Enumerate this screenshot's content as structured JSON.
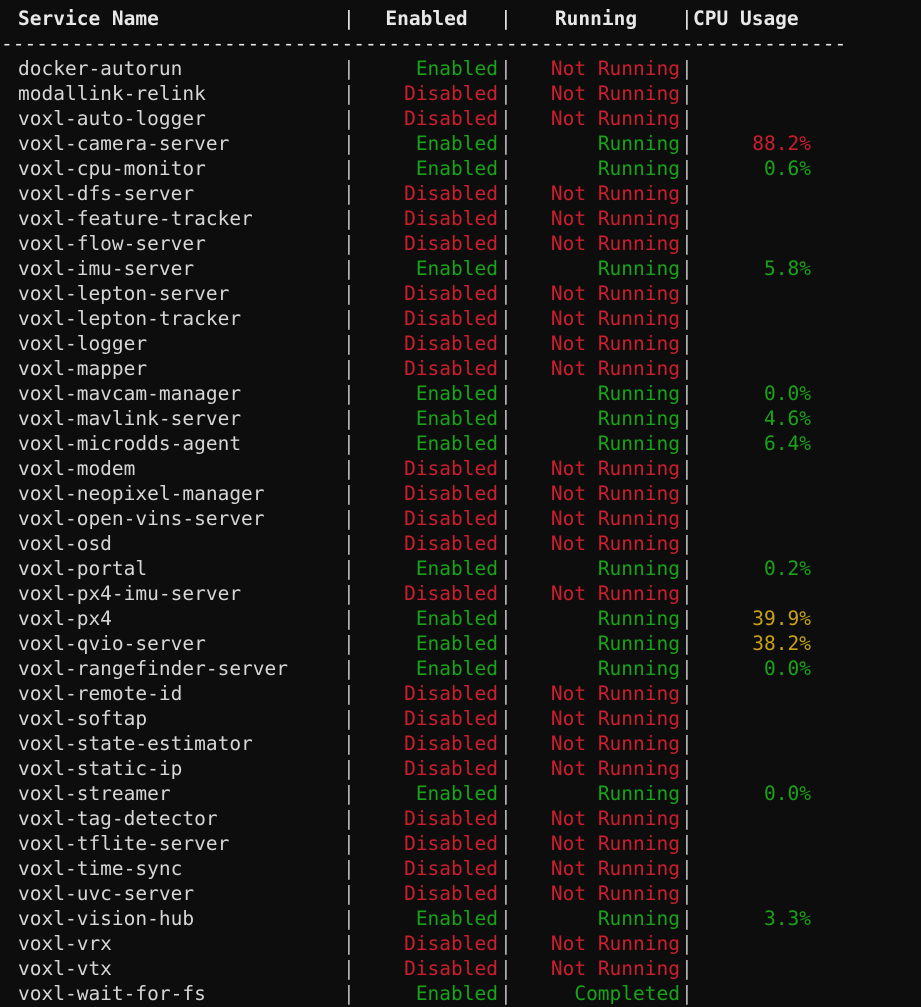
{
  "terminal": {
    "background": "#0d0d0d",
    "foreground": "#d6d6d6",
    "colors": {
      "enabled_green": "#19a319",
      "disabled_red": "#cc1f2e",
      "cpu_warn_yellow": "#c8a217",
      "cpu_crit_red": "#cc1f2e",
      "separator_gray": "#b8b8b8",
      "header_white": "#e8e8e8"
    }
  },
  "header": {
    "service_name": "Service Name",
    "enabled": "Enabled",
    "running": "Running",
    "cpu_usage": "CPU Usage",
    "pipe": "|",
    "divider": "------------------------------------------------------------------------"
  },
  "table": {
    "columns": [
      "Service Name",
      "Enabled",
      "Running",
      "CPU Usage"
    ],
    "rows": [
      {
        "name": "docker-autorun",
        "enabled": "Enabled",
        "running": "Not Running",
        "cpu": "",
        "enabled_state": "on",
        "running_state": "off",
        "cpu_state": "none"
      },
      {
        "name": "modallink-relink",
        "enabled": "Disabled",
        "running": "Not Running",
        "cpu": "",
        "enabled_state": "off",
        "running_state": "off",
        "cpu_state": "none"
      },
      {
        "name": "voxl-auto-logger",
        "enabled": "Disabled",
        "running": "Not Running",
        "cpu": "",
        "enabled_state": "off",
        "running_state": "off",
        "cpu_state": "none"
      },
      {
        "name": "voxl-camera-server",
        "enabled": "Enabled",
        "running": "Running",
        "cpu": "88.2%",
        "enabled_state": "on",
        "running_state": "on",
        "cpu_state": "crit"
      },
      {
        "name": "voxl-cpu-monitor",
        "enabled": "Enabled",
        "running": "Running",
        "cpu": "0.6%",
        "enabled_state": "on",
        "running_state": "on",
        "cpu_state": "ok"
      },
      {
        "name": "voxl-dfs-server",
        "enabled": "Disabled",
        "running": "Not Running",
        "cpu": "",
        "enabled_state": "off",
        "running_state": "off",
        "cpu_state": "none"
      },
      {
        "name": "voxl-feature-tracker",
        "enabled": "Disabled",
        "running": "Not Running",
        "cpu": "",
        "enabled_state": "off",
        "running_state": "off",
        "cpu_state": "none"
      },
      {
        "name": "voxl-flow-server",
        "enabled": "Disabled",
        "running": "Not Running",
        "cpu": "",
        "enabled_state": "off",
        "running_state": "off",
        "cpu_state": "none"
      },
      {
        "name": "voxl-imu-server",
        "enabled": "Enabled",
        "running": "Running",
        "cpu": "5.8%",
        "enabled_state": "on",
        "running_state": "on",
        "cpu_state": "ok"
      },
      {
        "name": "voxl-lepton-server",
        "enabled": "Disabled",
        "running": "Not Running",
        "cpu": "",
        "enabled_state": "off",
        "running_state": "off",
        "cpu_state": "none"
      },
      {
        "name": "voxl-lepton-tracker",
        "enabled": "Disabled",
        "running": "Not Running",
        "cpu": "",
        "enabled_state": "off",
        "running_state": "off",
        "cpu_state": "none"
      },
      {
        "name": "voxl-logger",
        "enabled": "Disabled",
        "running": "Not Running",
        "cpu": "",
        "enabled_state": "off",
        "running_state": "off",
        "cpu_state": "none"
      },
      {
        "name": "voxl-mapper",
        "enabled": "Disabled",
        "running": "Not Running",
        "cpu": "",
        "enabled_state": "off",
        "running_state": "off",
        "cpu_state": "none"
      },
      {
        "name": "voxl-mavcam-manager",
        "enabled": "Enabled",
        "running": "Running",
        "cpu": "0.0%",
        "enabled_state": "on",
        "running_state": "on",
        "cpu_state": "ok"
      },
      {
        "name": "voxl-mavlink-server",
        "enabled": "Enabled",
        "running": "Running",
        "cpu": "4.6%",
        "enabled_state": "on",
        "running_state": "on",
        "cpu_state": "ok"
      },
      {
        "name": "voxl-microdds-agent",
        "enabled": "Enabled",
        "running": "Running",
        "cpu": "6.4%",
        "enabled_state": "on",
        "running_state": "on",
        "cpu_state": "ok"
      },
      {
        "name": "voxl-modem",
        "enabled": "Disabled",
        "running": "Not Running",
        "cpu": "",
        "enabled_state": "off",
        "running_state": "off",
        "cpu_state": "none"
      },
      {
        "name": "voxl-neopixel-manager",
        "enabled": "Disabled",
        "running": "Not Running",
        "cpu": "",
        "enabled_state": "off",
        "running_state": "off",
        "cpu_state": "none"
      },
      {
        "name": "voxl-open-vins-server",
        "enabled": "Disabled",
        "running": "Not Running",
        "cpu": "",
        "enabled_state": "off",
        "running_state": "off",
        "cpu_state": "none"
      },
      {
        "name": "voxl-osd",
        "enabled": "Disabled",
        "running": "Not Running",
        "cpu": "",
        "enabled_state": "off",
        "running_state": "off",
        "cpu_state": "none"
      },
      {
        "name": "voxl-portal",
        "enabled": "Enabled",
        "running": "Running",
        "cpu": "0.2%",
        "enabled_state": "on",
        "running_state": "on",
        "cpu_state": "ok"
      },
      {
        "name": "voxl-px4-imu-server",
        "enabled": "Disabled",
        "running": "Not Running",
        "cpu": "",
        "enabled_state": "off",
        "running_state": "off",
        "cpu_state": "none"
      },
      {
        "name": "voxl-px4",
        "enabled": "Enabled",
        "running": "Running",
        "cpu": "39.9%",
        "enabled_state": "on",
        "running_state": "on",
        "cpu_state": "warn"
      },
      {
        "name": "voxl-qvio-server",
        "enabled": "Enabled",
        "running": "Running",
        "cpu": "38.2%",
        "enabled_state": "on",
        "running_state": "on",
        "cpu_state": "warn"
      },
      {
        "name": "voxl-rangefinder-server",
        "enabled": "Enabled",
        "running": "Running",
        "cpu": "0.0%",
        "enabled_state": "on",
        "running_state": "on",
        "cpu_state": "ok"
      },
      {
        "name": "voxl-remote-id",
        "enabled": "Disabled",
        "running": "Not Running",
        "cpu": "",
        "enabled_state": "off",
        "running_state": "off",
        "cpu_state": "none"
      },
      {
        "name": "voxl-softap",
        "enabled": "Disabled",
        "running": "Not Running",
        "cpu": "",
        "enabled_state": "off",
        "running_state": "off",
        "cpu_state": "none"
      },
      {
        "name": "voxl-state-estimator",
        "enabled": "Disabled",
        "running": "Not Running",
        "cpu": "",
        "enabled_state": "off",
        "running_state": "off",
        "cpu_state": "none"
      },
      {
        "name": "voxl-static-ip",
        "enabled": "Disabled",
        "running": "Not Running",
        "cpu": "",
        "enabled_state": "off",
        "running_state": "off",
        "cpu_state": "none"
      },
      {
        "name": "voxl-streamer",
        "enabled": "Enabled",
        "running": "Running",
        "cpu": "0.0%",
        "enabled_state": "on",
        "running_state": "on",
        "cpu_state": "ok"
      },
      {
        "name": "voxl-tag-detector",
        "enabled": "Disabled",
        "running": "Not Running",
        "cpu": "",
        "enabled_state": "off",
        "running_state": "off",
        "cpu_state": "none"
      },
      {
        "name": "voxl-tflite-server",
        "enabled": "Disabled",
        "running": "Not Running",
        "cpu": "",
        "enabled_state": "off",
        "running_state": "off",
        "cpu_state": "none"
      },
      {
        "name": "voxl-time-sync",
        "enabled": "Disabled",
        "running": "Not Running",
        "cpu": "",
        "enabled_state": "off",
        "running_state": "off",
        "cpu_state": "none"
      },
      {
        "name": "voxl-uvc-server",
        "enabled": "Disabled",
        "running": "Not Running",
        "cpu": "",
        "enabled_state": "off",
        "running_state": "off",
        "cpu_state": "none"
      },
      {
        "name": "voxl-vision-hub",
        "enabled": "Enabled",
        "running": "Running",
        "cpu": "3.3%",
        "enabled_state": "on",
        "running_state": "on",
        "cpu_state": "ok"
      },
      {
        "name": "voxl-vrx",
        "enabled": "Disabled",
        "running": "Not Running",
        "cpu": "",
        "enabled_state": "off",
        "running_state": "off",
        "cpu_state": "none"
      },
      {
        "name": "voxl-vtx",
        "enabled": "Disabled",
        "running": "Not Running",
        "cpu": "",
        "enabled_state": "off",
        "running_state": "off",
        "cpu_state": "none"
      },
      {
        "name": "voxl-wait-for-fs",
        "enabled": "Enabled",
        "running": "Completed",
        "cpu": "",
        "enabled_state": "on",
        "running_state": "on",
        "cpu_state": "none"
      }
    ]
  }
}
